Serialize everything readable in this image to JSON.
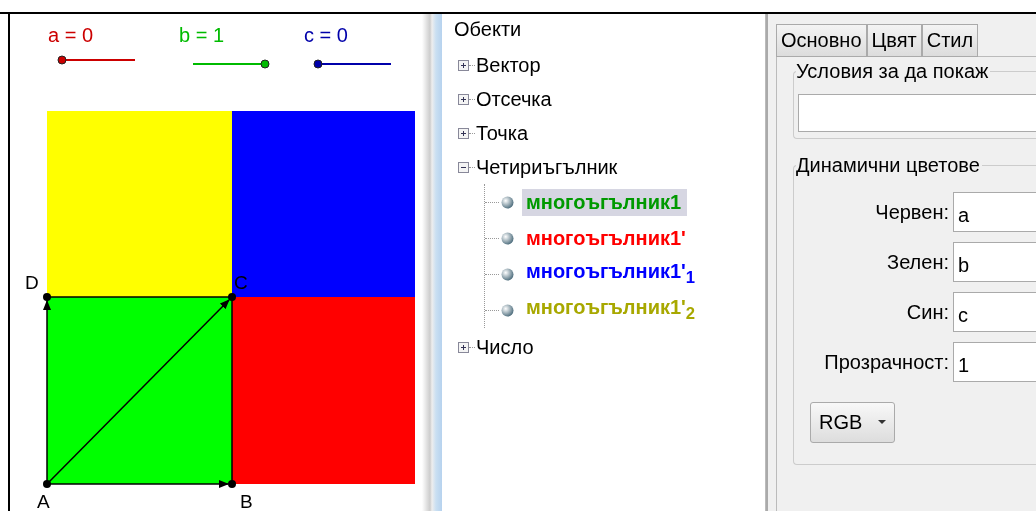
{
  "sliders": [
    {
      "label": "a = 0",
      "color": "#cc0000",
      "level": 0
    },
    {
      "label": "b = 1",
      "color": "#00bb00",
      "level": 1
    },
    {
      "label": "c = 0",
      "color": "#0000aa",
      "level": 0
    }
  ],
  "polygons": [
    {
      "color": "#ffff00"
    },
    {
      "color": "#0000ff"
    },
    {
      "color": "#00ff00"
    },
    {
      "color": "#ff0000"
    }
  ],
  "points": [
    {
      "label": "D"
    },
    {
      "label": "C"
    },
    {
      "label": "A"
    },
    {
      "label": "B"
    }
  ],
  "tree": {
    "title": "Обекти",
    "items": [
      {
        "label": "Вектор",
        "expanded": false
      },
      {
        "label": "Отсечка",
        "expanded": false
      },
      {
        "label": "Точка",
        "expanded": false
      },
      {
        "label": "Четириъгълник",
        "expanded": true,
        "children": [
          {
            "label": "многоъгълник1",
            "color": "#009900",
            "selected": true
          },
          {
            "label": "многоъгълник1'",
            "color": "#ff0000",
            "selected": false
          },
          {
            "label": "многоъгълник1'$_{1}$",
            "color": "#0000ff",
            "selected": false
          },
          {
            "label": "многоъгълник1'$_{2}$",
            "color": "#a8a800",
            "selected": false
          }
        ]
      },
      {
        "label": "Число",
        "expanded": false
      }
    ]
  },
  "tabs": [
    {
      "label": "Основно"
    },
    {
      "label": "Цвят"
    },
    {
      "label": "Стил"
    }
  ],
  "condition_group": {
    "title": "Условия за да покаж"
  },
  "dynamic_colors": {
    "title": "Динамични цветове",
    "fields": [
      {
        "label": "Червен:",
        "value": "a"
      },
      {
        "label": "Зелен:",
        "value": "b"
      },
      {
        "label": "Син:",
        "value": "c"
      },
      {
        "label": "Прозрачност:",
        "value": "1"
      }
    ],
    "mode": "RGB"
  }
}
